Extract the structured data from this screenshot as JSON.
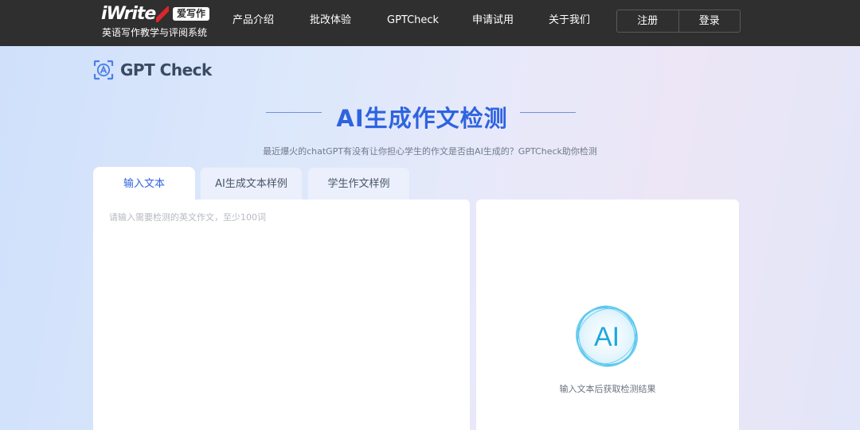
{
  "header": {
    "logo_text": "iWrite",
    "logo_badge": "爱写作",
    "logo_subtitle": "英语写作教学与评阅系统",
    "nav": [
      {
        "label": "产品介绍"
      },
      {
        "label": "批改体验"
      },
      {
        "label": "GPTCheck"
      },
      {
        "label": "申请试用"
      },
      {
        "label": "关于我们"
      }
    ],
    "register_label": "注册",
    "login_label": "登录"
  },
  "brand": {
    "name": "GPT Check",
    "icon": "ai-scan-icon"
  },
  "hero": {
    "title": "AI生成作文检测",
    "subtitle": "最近爆火的chatGPT有没有让你担心学生的作文是否由AI生成的？GPTCheck助你检测"
  },
  "tabs": [
    {
      "label": "输入文本",
      "active": true
    },
    {
      "label": "AI生成文本样例",
      "active": false
    },
    {
      "label": "学生作文样例",
      "active": false
    }
  ],
  "input": {
    "placeholder": "请输入需要检测的英文作文，至少100词",
    "value": ""
  },
  "result": {
    "orb_text": "AI",
    "hint": "输入文本后获取检测结果"
  },
  "colors": {
    "accent": "#2f63e0",
    "topbar": "#2f2f2f",
    "logo_red": "#d9262c",
    "orb": "#29b6e8"
  }
}
